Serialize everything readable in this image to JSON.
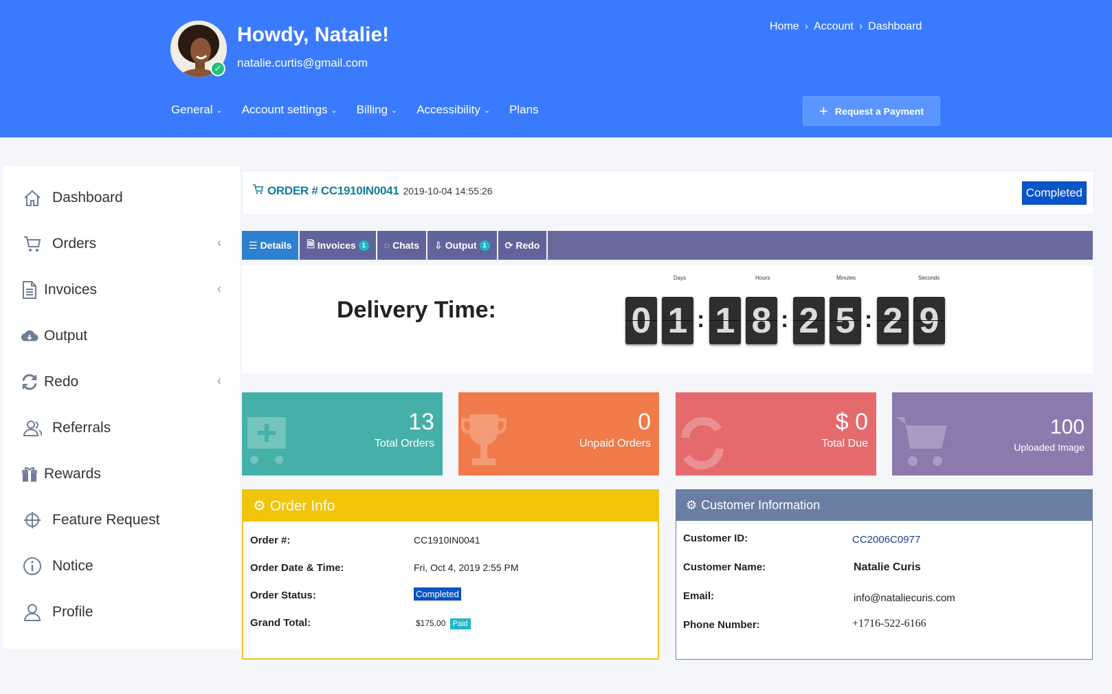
{
  "header": {
    "greeting": "Howdy, Natalie!",
    "email": "natalie.curtis@gmail.com",
    "breadcrumb": [
      "Home",
      "Account",
      "Dashboard"
    ],
    "nav": [
      {
        "label": "General",
        "dropdown": true
      },
      {
        "label": "Account settings",
        "dropdown": true
      },
      {
        "label": "Billing",
        "dropdown": true
      },
      {
        "label": "Accessibility",
        "dropdown": true
      },
      {
        "label": "Plans",
        "dropdown": false
      }
    ],
    "request_button": "Request a Payment"
  },
  "sidebar": {
    "items": [
      {
        "label": "Dashboard",
        "icon": "home-icon"
      },
      {
        "label": "Orders",
        "icon": "cart-icon",
        "expandable": true
      },
      {
        "label": "Invoices",
        "icon": "document-icon",
        "expandable": true
      },
      {
        "label": "Output",
        "icon": "cloud-download-icon"
      },
      {
        "label": "Redo",
        "icon": "refresh-icon",
        "expandable": true
      },
      {
        "label": "Referrals",
        "icon": "users-icon"
      },
      {
        "label": "Rewards",
        "icon": "gift-icon"
      },
      {
        "label": "Feature Request",
        "icon": "crosshair-icon"
      },
      {
        "label": "Notice",
        "icon": "info-icon"
      },
      {
        "label": "Profile",
        "icon": "user-icon"
      }
    ]
  },
  "order": {
    "label": "ORDER # CC1910IN0041",
    "datetime": "2019-10-04 14:55:26",
    "status": "Completed"
  },
  "tabs": [
    {
      "label": "Details",
      "badge": ""
    },
    {
      "label": "Invoices",
      "badge": "1"
    },
    {
      "label": "Chats",
      "badge": ""
    },
    {
      "label": "Output",
      "badge": "1"
    },
    {
      "label": "Redo",
      "badge": ""
    }
  ],
  "delivery": {
    "label": "Delivery Time:",
    "captions": {
      "days": "Days",
      "hours": "Hours",
      "minutes": "Minutes",
      "seconds": "Seconds"
    },
    "digits": [
      "0",
      "1",
      "1",
      "8",
      "2",
      "5",
      "2",
      "9"
    ]
  },
  "stats": [
    {
      "value": "13",
      "caption": "Total Orders",
      "color": "#45b0a8"
    },
    {
      "value": "0",
      "caption": "Unpaid Orders",
      "color": "#f07a4a"
    },
    {
      "value": "$ 0",
      "caption": "Total Due",
      "color": "#e46a6e"
    },
    {
      "value": "100",
      "caption": "Uploaded Image",
      "color": "#8c79ae"
    }
  ],
  "order_info": {
    "title": "Order Info",
    "rows": [
      {
        "label": "Order #:",
        "value": "CC1910IN0041"
      },
      {
        "label": "Order Date & Time:",
        "value": "Fri, Oct 4, 2019 2:55 PM"
      },
      {
        "label": "Order Status:",
        "value": "Completed"
      },
      {
        "label": "Grand Total:",
        "value": "$175.00",
        "badge": "Paid"
      }
    ]
  },
  "customer_info": {
    "title": "Customer Information",
    "rows": [
      {
        "label": "Customer ID:",
        "value": "CC2006C0977"
      },
      {
        "label": "Customer Name:",
        "value": "Natalie Curis"
      },
      {
        "label": "Email:",
        "value": "info@nataliecuris.com"
      },
      {
        "label": "Phone Number:",
        "value": "+1716-522-6166"
      }
    ]
  }
}
